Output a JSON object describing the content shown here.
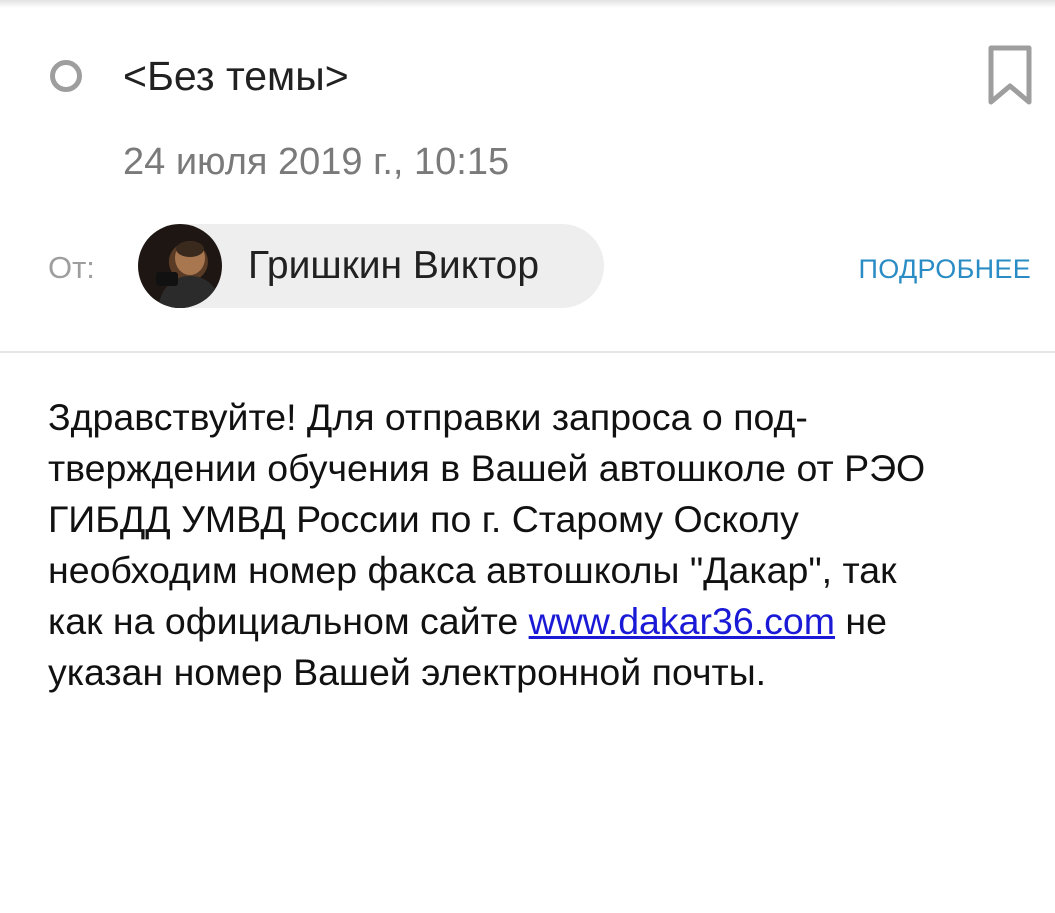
{
  "message": {
    "subject": "<Без темы>",
    "date": "24 июля 2019 г., 10:15",
    "from_label": "От:",
    "sender_name": "Гришкин Виктор",
    "details_label": "ПОДРОБНЕЕ"
  },
  "icons": {
    "read_indicator": "circle-outline-icon",
    "bookmark": "bookmark-icon"
  },
  "colors": {
    "link": "#2a8cc4",
    "body_link": "#1a1ad6",
    "secondary_text": "#7a7a7a"
  },
  "body": {
    "lines": [
      "Здравствуйте! Для отправки запроса о под-",
      "тверждении обучения в Вашей автошколе от РЭО",
      "ГИБДД УМВД России по г. Старому Осколу",
      "необходим номер факса автошколы \"Дакар\", так"
    ],
    "line5_before": "как на официальном сайте ",
    "link_text": "www.dakar36.com",
    "line5_after": " не",
    "line6": "указан номер Вашей электронной почты."
  }
}
